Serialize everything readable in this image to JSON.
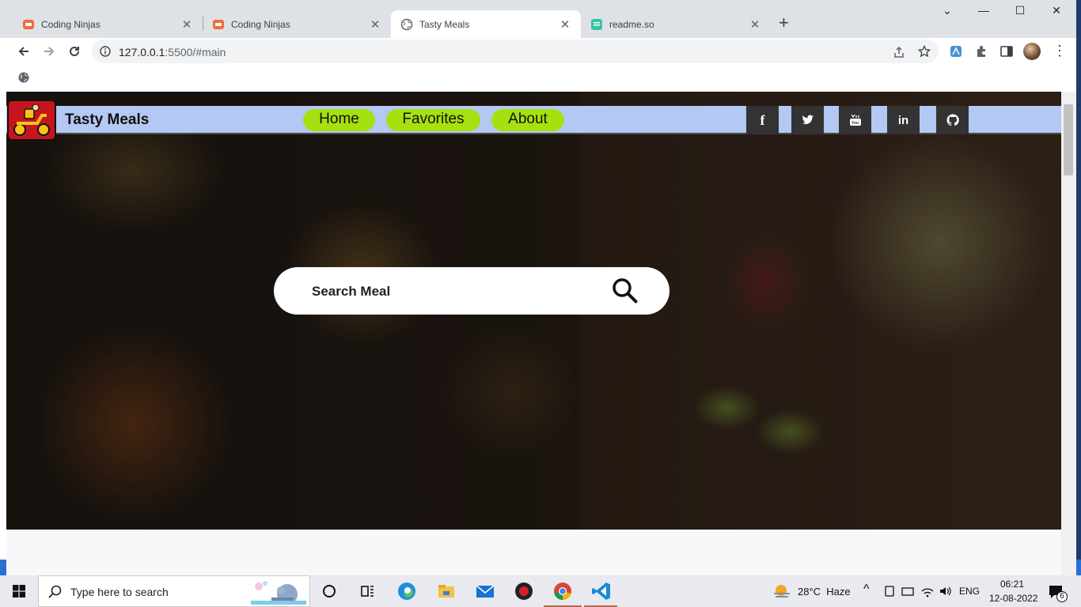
{
  "browser": {
    "tabs": [
      {
        "title": "Coding Ninjas",
        "icon": "coding-ninjas-icon",
        "active": false
      },
      {
        "title": "Coding Ninjas",
        "icon": "coding-ninjas-icon",
        "active": false
      },
      {
        "title": "Tasty Meals",
        "icon": "globe-icon",
        "active": true
      },
      {
        "title": "readme.so",
        "icon": "readme-icon",
        "active": false
      }
    ],
    "url_host": "127.0.0.1",
    "url_rest": ":5500/#main",
    "window_controls": {
      "minimize": "—",
      "maximize": "☐",
      "close": "✕",
      "dropdown": "⌄"
    },
    "new_tab": "+"
  },
  "site": {
    "brand": "Tasty Meals",
    "nav": [
      "Home",
      "Favorites",
      "About"
    ],
    "social": [
      {
        "label": "f",
        "icon": "facebook-icon"
      },
      {
        "label": "t",
        "icon": "twitter-icon"
      },
      {
        "label": "▶",
        "icon": "youtube-icon"
      },
      {
        "label": "in",
        "icon": "linkedin-icon"
      },
      {
        "label": "gh",
        "icon": "github-icon"
      }
    ],
    "search_placeholder": "Search Meal",
    "colors": {
      "navbar": "#b3c8f2",
      "pill": "#a7e00f",
      "social": "#333333",
      "logo": "#c4161c"
    }
  },
  "taskbar": {
    "search_text": "Type here to search",
    "weather": "28°C  Haze",
    "language": "ENG",
    "time": "06:21",
    "date": "12-08-2022",
    "notifications": "6"
  }
}
